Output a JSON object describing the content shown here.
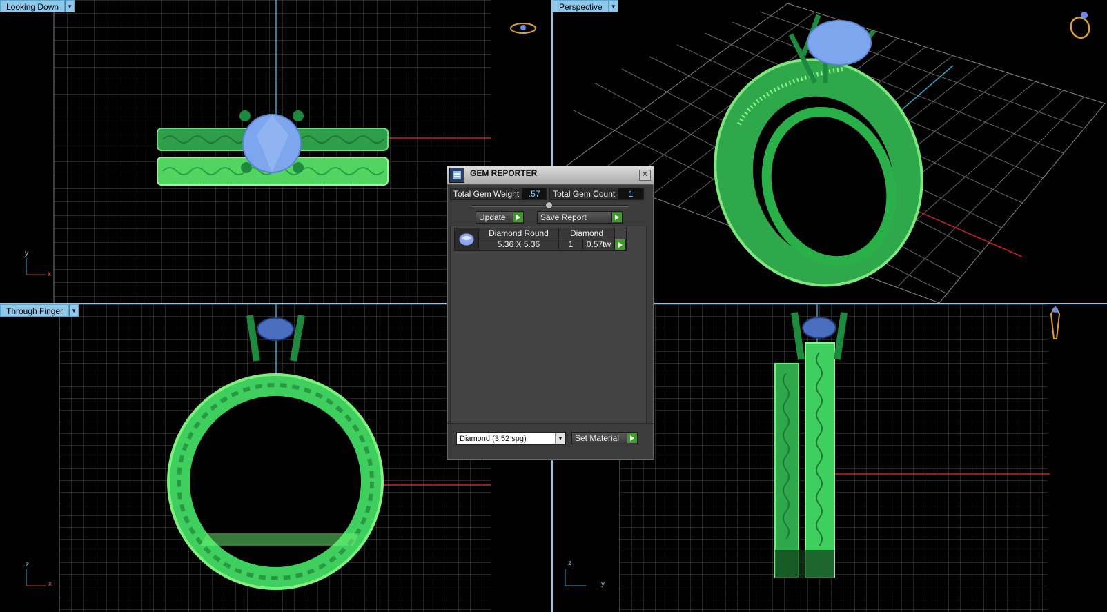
{
  "viewports": {
    "top_left": {
      "label": "Looking Down",
      "axis_a": "y",
      "axis_b": "x"
    },
    "top_right": {
      "label": "Perspective"
    },
    "bottom_left": {
      "label": "Through Finger",
      "axis_a": "z",
      "axis_b": "x"
    },
    "bottom_right": {
      "axis_a": "z",
      "axis_b": "y"
    }
  },
  "gem_reporter": {
    "title": "GEM REPORTER",
    "close_label": "✕",
    "total_gem_weight_label": "Total Gem Weight",
    "total_gem_weight_value": ".57",
    "total_gem_count_label": "Total Gem Count",
    "total_gem_count_value": "1",
    "update_label": "Update",
    "save_report_label": "Save Report",
    "gems": [
      {
        "shape": "Diamond Round",
        "material": "Diamond",
        "size": "5.36 X 5.36",
        "count": "1",
        "weight": "0.57tw"
      }
    ],
    "material_selected": "Diamond     (3.52 spg)",
    "set_material_label": "Set Material"
  },
  "colors": {
    "viewport_label_bg": "#8ec8ea",
    "ring_green": "#3fcf5f",
    "gem_blue": "#7ea6ee",
    "accent_green_button": "#3f9b2c"
  }
}
